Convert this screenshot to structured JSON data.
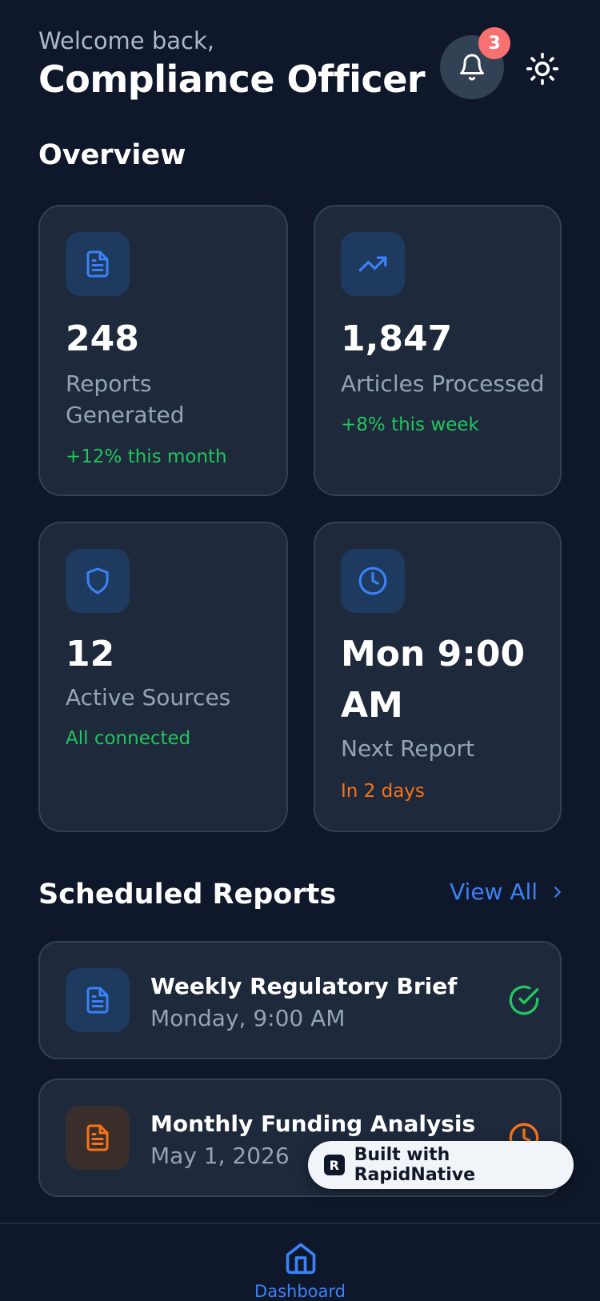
{
  "header": {
    "greeting": "Welcome back,",
    "role": "Compliance Officer",
    "notification_count": "3"
  },
  "overview": {
    "title": "Overview",
    "cards": [
      {
        "value": "248",
        "label": "Reports Generated",
        "note": "+12% this month",
        "icon": "document-icon"
      },
      {
        "value": "1,847",
        "label": "Articles Processed",
        "note": "+8% this week",
        "icon": "trending-up-icon"
      },
      {
        "value": "12",
        "label": "Active Sources",
        "note": "All connected",
        "icon": "shield-icon"
      },
      {
        "value": "Mon 9:00 AM",
        "label": "Next Report",
        "note": "In 2 days",
        "icon": "clock-icon"
      }
    ]
  },
  "scheduled": {
    "title": "Scheduled Reports",
    "view_all": "View All",
    "items": [
      {
        "name": "Weekly Regulatory Brief",
        "time": "Monday, 9:00 AM",
        "status": "completed"
      },
      {
        "name": "Monthly Funding Analysis",
        "time": "May 1, 2026",
        "status": "pending"
      }
    ]
  },
  "badge": {
    "text": "Built with RapidNative"
  },
  "nav": {
    "dashboard_label": "Dashboard"
  },
  "colors": {
    "background": "#0f172a",
    "card": "#1e293b",
    "accent": "#3b82f6",
    "positive": "#22c55e",
    "warning": "#f97316",
    "badge": "#f87171"
  }
}
